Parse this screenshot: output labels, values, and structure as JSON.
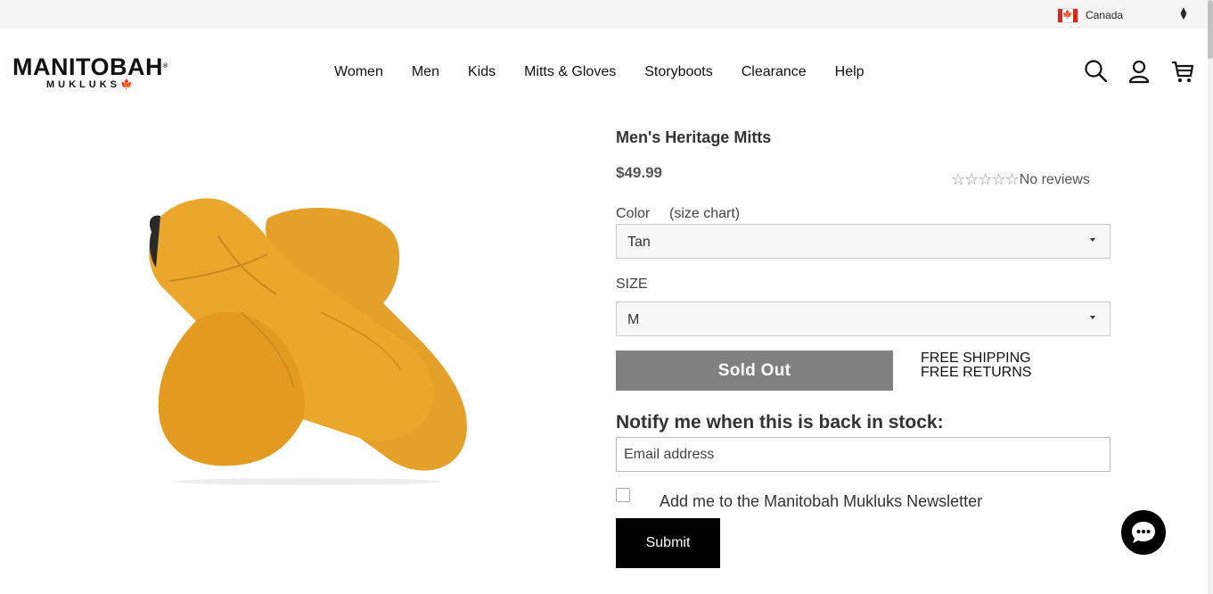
{
  "topbar": {
    "country": "Canada",
    "country_flag_icon": "canada-flag-icon",
    "country_select_icon": "up-down-arrows-icon"
  },
  "brand": {
    "name": "MANITOBAH",
    "sub": "MUKLUKS",
    "registered": "®"
  },
  "nav": {
    "items": [
      {
        "label": "Women"
      },
      {
        "label": "Men"
      },
      {
        "label": "Kids"
      },
      {
        "label": "Mitts & Gloves"
      },
      {
        "label": "Storyboots"
      },
      {
        "label": "Clearance"
      },
      {
        "label": "Help"
      }
    ]
  },
  "header_icons": [
    "search-icon",
    "account-icon",
    "cart-icon"
  ],
  "product": {
    "title": "Men's Heritage Mitts",
    "price": "$49.99",
    "rating_stars": "☆☆☆☆☆",
    "rating": 0,
    "reviews_text": "No reviews",
    "color_label": "Color",
    "size_chart_link": "(size chart)",
    "color_value": "Tan",
    "size_label": "SIZE",
    "size_value": "M",
    "sold_out_label": "Sold Out",
    "free_shipping": "FREE SHIPPING",
    "free_returns": "FREE RETURNS",
    "image_color": "#e8a227"
  },
  "notify": {
    "heading": "Notify me when this is back in stock:",
    "email_value": "Email address",
    "newsletter_label": "Add me to the Manitobah Mukluks Newsletter",
    "newsletter_checked": false,
    "submit_label": "Submit"
  },
  "chat": {
    "icon": "chat-bubble-icon"
  },
  "colors": {
    "topbar_bg": "#f5f5f5",
    "sold_out_bg": "#808080",
    "submit_bg": "#000000",
    "flag_red": "#d52b1e"
  }
}
